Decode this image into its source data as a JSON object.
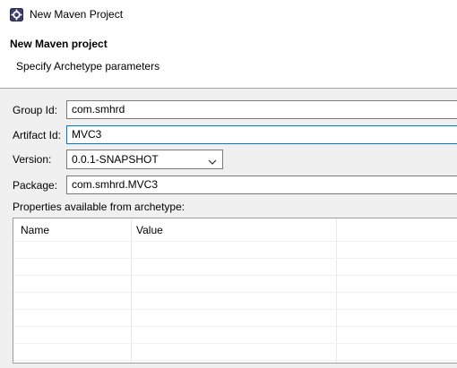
{
  "window": {
    "title": "New Maven Project",
    "icon": "maven-wizard-icon"
  },
  "header": {
    "title": "New Maven project",
    "subtitle": "Specify Archetype parameters"
  },
  "form": {
    "group_id": {
      "label": "Group Id:",
      "value": "com.smhrd"
    },
    "artifact_id": {
      "label": "Artifact Id:",
      "value": "MVC3"
    },
    "version": {
      "label": "Version:",
      "value": "0.0.1-SNAPSHOT"
    },
    "package": {
      "label": "Package:",
      "value": "com.smhrd.MVC3"
    }
  },
  "properties": {
    "label": "Properties available from archetype:",
    "columns": [
      "Name",
      "Value"
    ],
    "rows": []
  },
  "colors": {
    "focus_border": "#0078d7",
    "field_border": "#7a7a7a",
    "dialog_background": "#f0f0f0"
  }
}
